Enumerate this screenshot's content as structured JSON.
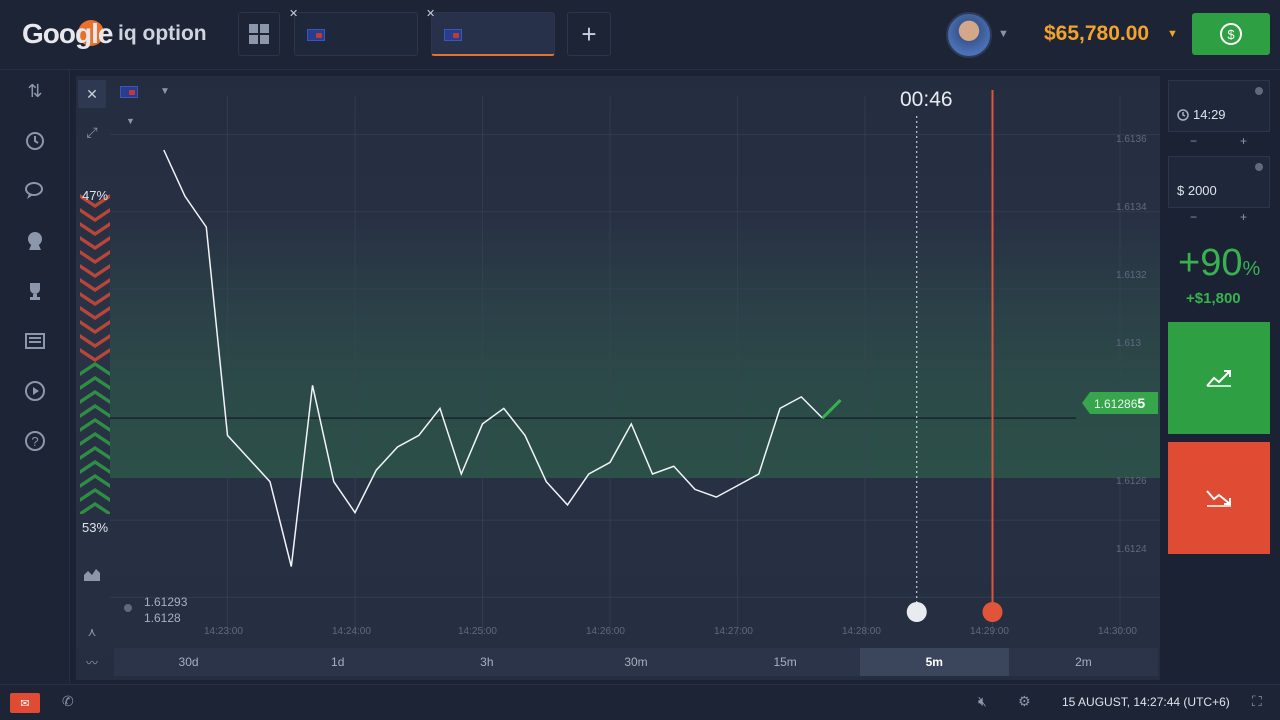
{
  "header": {
    "brand_google": "Google",
    "brand_iq": "iq option",
    "balance": "$65,780.00"
  },
  "chart": {
    "countdown": "00:46",
    "sentiment_up": "47%",
    "sentiment_down": "53%",
    "current_price_main": "1.61286",
    "current_price_last": "5",
    "ohlc_high": "1.61293",
    "ohlc_low": "1.6128",
    "y_ticks": [
      "1.6136",
      "1.6134",
      "1.6132",
      "1.613",
      "1.6126",
      "1.6124"
    ],
    "x_ticks": [
      "14:23:00",
      "14:24:00",
      "14:25:00",
      "14:26:00",
      "14:27:00",
      "14:28:00",
      "14:29:00",
      "14:30:00"
    ],
    "timeframes": [
      "30d",
      "1d",
      "3h",
      "30m",
      "15m",
      "5m",
      "2m"
    ],
    "active_timeframe": "5m"
  },
  "trade_panel": {
    "expiry": "14:29",
    "amount": "$ 2000",
    "payout_pct": "+90",
    "payout_pct_sign": "%",
    "payout_amount": "+$1,800",
    "minus": "−",
    "plus": "+"
  },
  "footer": {
    "datetime": "15 AUGUST, 14:27:44",
    "timezone": "(UTC+6)"
  },
  "colors": {
    "call": "#2ea043",
    "put": "#e04c33",
    "balance": "#f3a22a",
    "accent": "#e8722c"
  },
  "chart_data": {
    "type": "line",
    "series": [
      {
        "x": [
          "14:22:30",
          "14:22:40",
          "14:22:50",
          "14:23:00",
          "14:23:10",
          "14:23:20",
          "14:23:30",
          "14:23:40",
          "14:23:50",
          "14:24:00",
          "14:24:10",
          "14:24:20",
          "14:24:30",
          "14:24:40",
          "14:24:50",
          "14:25:00",
          "14:25:10",
          "14:25:20",
          "14:25:30",
          "14:25:40",
          "14:25:50",
          "14:26:00",
          "14:26:10",
          "14:26:20",
          "14:26:30",
          "14:26:40",
          "14:26:50",
          "14:27:00",
          "14:27:10",
          "14:27:20",
          "14:27:30",
          "14:27:40"
        ],
        "values": [
          1.61356,
          1.61344,
          1.61336,
          1.61282,
          1.61276,
          1.6127,
          1.61248,
          1.61295,
          1.6127,
          1.61262,
          1.61273,
          1.61279,
          1.61282,
          1.61289,
          1.61272,
          1.61285,
          1.61289,
          1.61282,
          1.6127,
          1.61264,
          1.61272,
          1.61275,
          1.61285,
          1.61272,
          1.61274,
          1.61268,
          1.61266,
          1.61269,
          1.61272,
          1.61289,
          1.61292,
          1.612865
        ]
      }
    ],
    "ylim": [
      1.6123,
      1.6137
    ],
    "grid": true
  }
}
